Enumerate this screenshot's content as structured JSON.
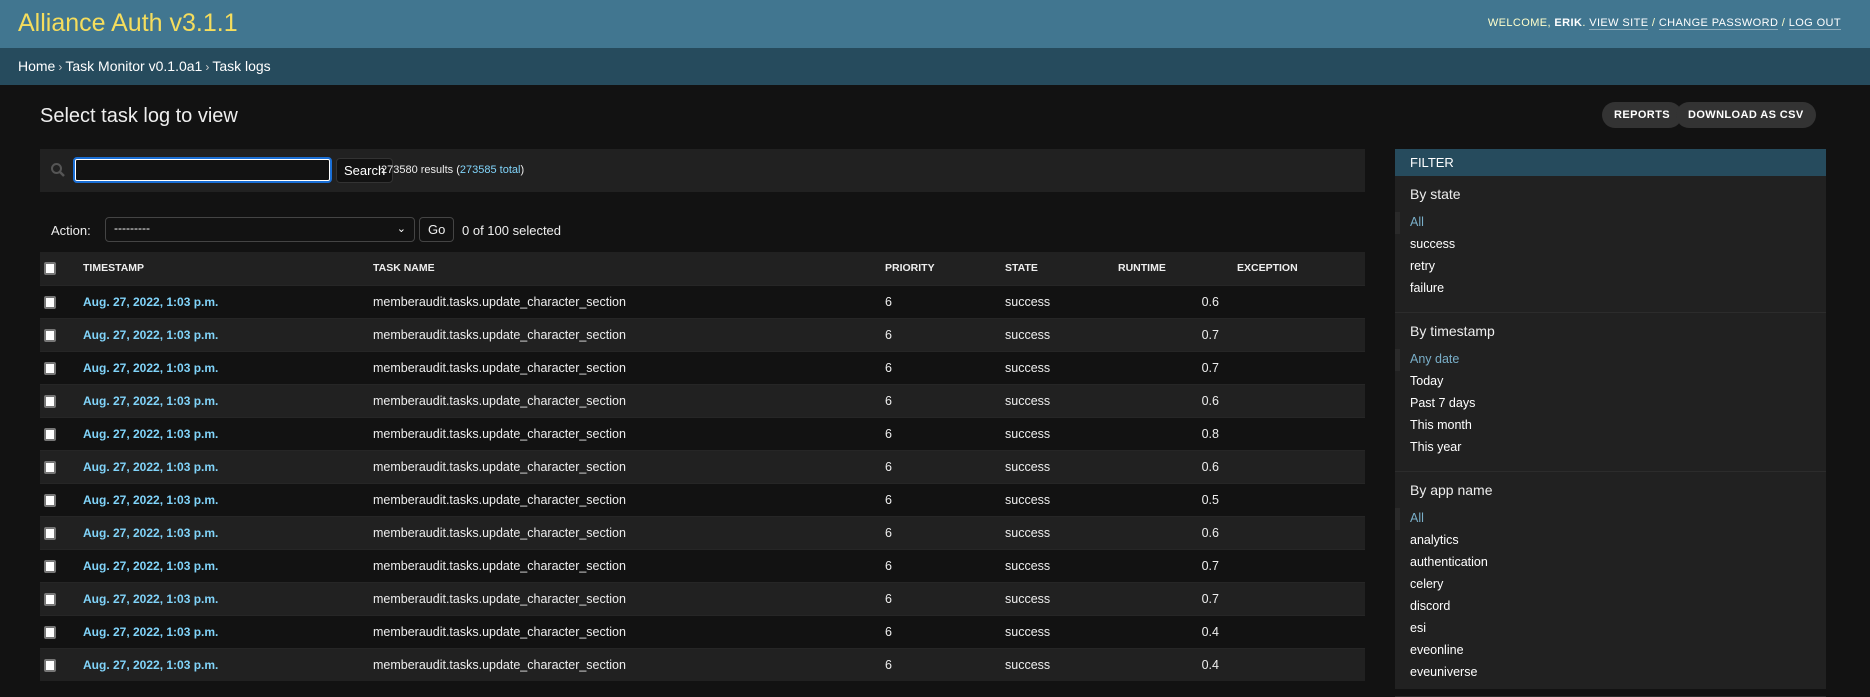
{
  "header": {
    "brand": "Alliance Auth v3.1.1",
    "welcome": "WELCOME, ",
    "user": "ERIK",
    "view_site": "VIEW SITE",
    "change_password": "CHANGE PASSWORD",
    "log_out": "LOG OUT"
  },
  "breadcrumbs": [
    "Home",
    "Task Monitor v0.1.0a1",
    "Task logs"
  ],
  "page_title": "Select task log to view",
  "object_tools": {
    "reports": "REPORTS",
    "download": "DOWNLOAD AS CSV"
  },
  "search": {
    "value": "",
    "button": "Search",
    "results": "273580 results (",
    "total": "273585 total",
    ")": ")"
  },
  "actions": {
    "label": "Action:",
    "selected": "---------",
    "go": "Go",
    "selection": "0 of 100 selected"
  },
  "table": {
    "headers": [
      "TIMESTAMP",
      "TASK NAME",
      "PRIORITY",
      "STATE",
      "RUNTIME",
      "EXCEPTION"
    ],
    "rows": [
      {
        "timestamp": "Aug. 27, 2022, 1:03 p.m.",
        "task": "memberaudit.tasks.update_character_section",
        "priority": "6",
        "state": "success",
        "runtime": "0.6",
        "exception": ""
      },
      {
        "timestamp": "Aug. 27, 2022, 1:03 p.m.",
        "task": "memberaudit.tasks.update_character_section",
        "priority": "6",
        "state": "success",
        "runtime": "0.7",
        "exception": ""
      },
      {
        "timestamp": "Aug. 27, 2022, 1:03 p.m.",
        "task": "memberaudit.tasks.update_character_section",
        "priority": "6",
        "state": "success",
        "runtime": "0.7",
        "exception": ""
      },
      {
        "timestamp": "Aug. 27, 2022, 1:03 p.m.",
        "task": "memberaudit.tasks.update_character_section",
        "priority": "6",
        "state": "success",
        "runtime": "0.6",
        "exception": ""
      },
      {
        "timestamp": "Aug. 27, 2022, 1:03 p.m.",
        "task": "memberaudit.tasks.update_character_section",
        "priority": "6",
        "state": "success",
        "runtime": "0.8",
        "exception": ""
      },
      {
        "timestamp": "Aug. 27, 2022, 1:03 p.m.",
        "task": "memberaudit.tasks.update_character_section",
        "priority": "6",
        "state": "success",
        "runtime": "0.6",
        "exception": ""
      },
      {
        "timestamp": "Aug. 27, 2022, 1:03 p.m.",
        "task": "memberaudit.tasks.update_character_section",
        "priority": "6",
        "state": "success",
        "runtime": "0.5",
        "exception": ""
      },
      {
        "timestamp": "Aug. 27, 2022, 1:03 p.m.",
        "task": "memberaudit.tasks.update_character_section",
        "priority": "6",
        "state": "success",
        "runtime": "0.6",
        "exception": ""
      },
      {
        "timestamp": "Aug. 27, 2022, 1:03 p.m.",
        "task": "memberaudit.tasks.update_character_section",
        "priority": "6",
        "state": "success",
        "runtime": "0.7",
        "exception": ""
      },
      {
        "timestamp": "Aug. 27, 2022, 1:03 p.m.",
        "task": "memberaudit.tasks.update_character_section",
        "priority": "6",
        "state": "success",
        "runtime": "0.7",
        "exception": ""
      },
      {
        "timestamp": "Aug. 27, 2022, 1:03 p.m.",
        "task": "memberaudit.tasks.update_character_section",
        "priority": "6",
        "state": "success",
        "runtime": "0.4",
        "exception": ""
      },
      {
        "timestamp": "Aug. 27, 2022, 1:03 p.m.",
        "task": "memberaudit.tasks.update_character_section",
        "priority": "6",
        "state": "success",
        "runtime": "0.4",
        "exception": ""
      }
    ]
  },
  "filter": {
    "title": "FILTER",
    "groups": [
      {
        "title": "By state",
        "items": [
          "All",
          "success",
          "retry",
          "failure"
        ],
        "selected": 0
      },
      {
        "title": "By timestamp",
        "items": [
          "Any date",
          "Today",
          "Past 7 days",
          "This month",
          "This year"
        ],
        "selected": 0
      },
      {
        "title": "By app name",
        "items": [
          "All",
          "analytics",
          "authentication",
          "celery",
          "discord",
          "esi",
          "eveonline",
          "eveuniverse"
        ],
        "selected": 0
      }
    ]
  },
  "colors": {
    "header": "#417690",
    "breadcrumbs": "#264b5d",
    "brand": "#f5dd5d",
    "link": "#81d4fa",
    "selected_filter": "#79aec8"
  }
}
